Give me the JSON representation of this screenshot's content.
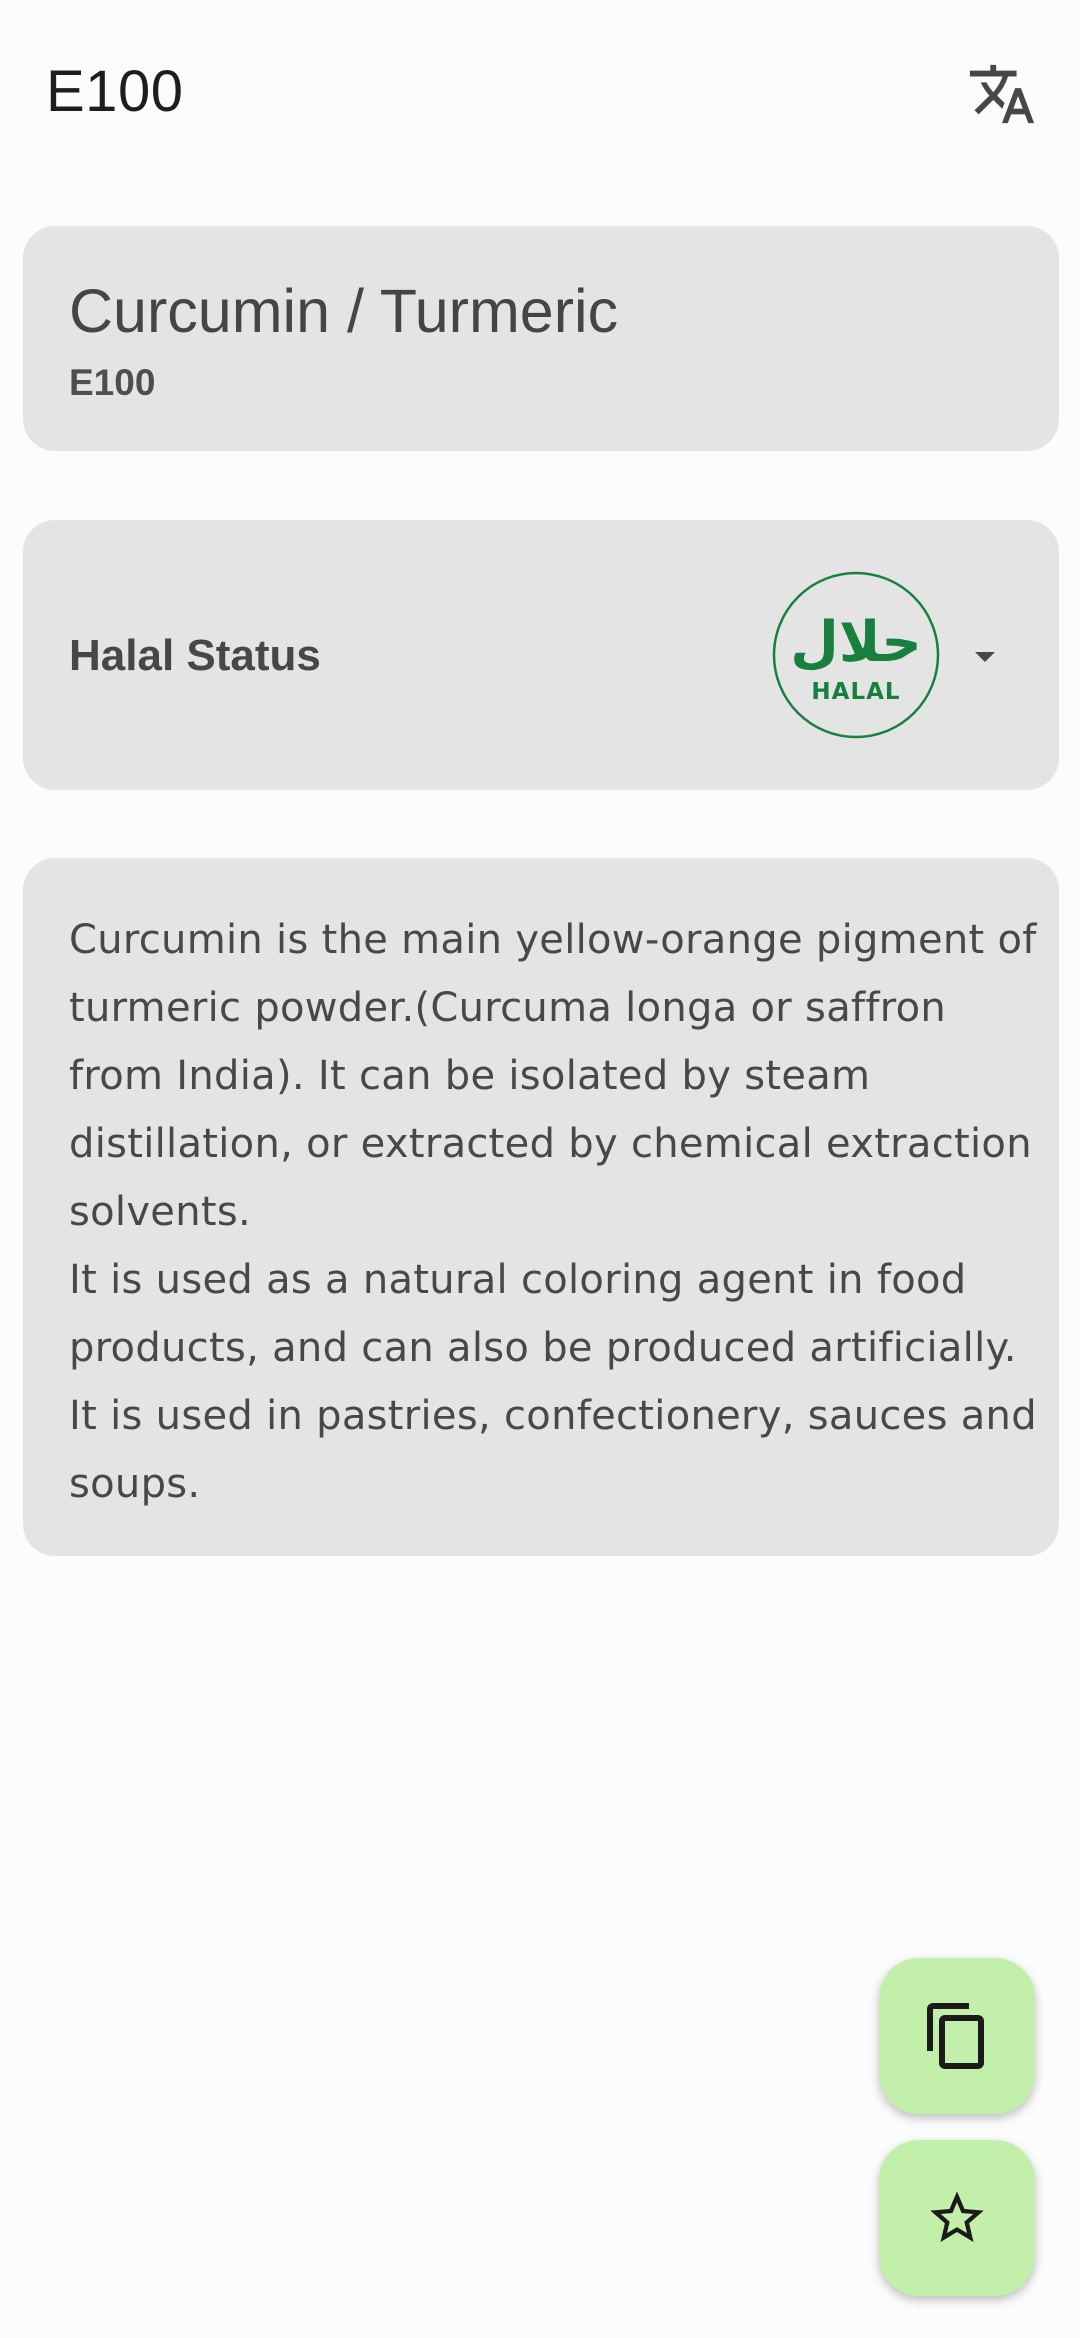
{
  "topbar": {
    "title": "E100",
    "translate_icon": "translate-icon"
  },
  "additive": {
    "name": "Curcumin / Turmeric",
    "code": "E100"
  },
  "halal_status": {
    "label": "Halal Status",
    "badge_text": "HALAL",
    "badge_arabic": "حلال",
    "badge_color": "#18803e",
    "dropdown_icon": "arrow-drop-down-icon"
  },
  "description": {
    "text": "Curcumin is the main yellow-orange pigment of turmeric powder.(Curcuma longa or saffron from India). It can be isolated by steam distillation, or extracted by chemical extraction solvents.\n It is used as a natural coloring agent in food products, and can also be produced artificially. It is used in pastries, confectionery, sauces and soups."
  },
  "fabs": {
    "copy_icon": "copy-icon",
    "favorite_icon": "star-outline-icon",
    "color": "#c2f0ab"
  }
}
